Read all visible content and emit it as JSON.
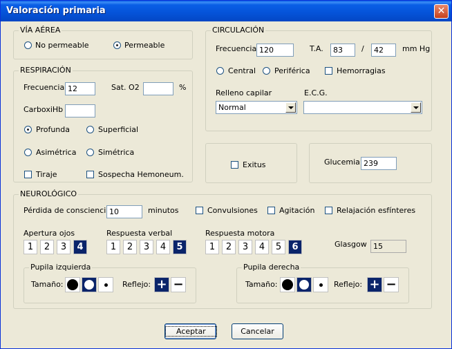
{
  "window": {
    "title": "Valoración primaria",
    "close_glyph": "✕"
  },
  "via_aerea": {
    "legend": "VÍA AÉREA",
    "options": [
      {
        "label": "No permeable",
        "checked": false
      },
      {
        "label": "Permeable",
        "checked": true
      }
    ]
  },
  "respiracion": {
    "legend": "RESPIRACIÓN",
    "frecuencia_label": "Frecuencia",
    "frecuencia_value": "12",
    "sat_label": "Sat. O2",
    "sat_value": "",
    "sat_unit": "%",
    "carboxi_label": "CarboxiHb",
    "carboxi_value": "",
    "profundidad": [
      {
        "label": "Profunda",
        "checked": true
      },
      {
        "label": "Superficial",
        "checked": false
      }
    ],
    "simetria": [
      {
        "label": "Asimétrica",
        "checked": false
      },
      {
        "label": "Simétrica",
        "checked": false
      }
    ],
    "tiraje_label": "Tiraje",
    "hemoneum_label": "Sospecha Hemoneum."
  },
  "circulacion": {
    "legend": "CIRCULACIÓN",
    "frecuencia_label": "Frecuencia",
    "frecuencia_value": "120",
    "ta_label": "T.A.",
    "ta_sys": "83",
    "ta_sep": "/",
    "ta_dia": "42",
    "ta_unit": "mm Hg",
    "pulso": [
      {
        "label": "Central",
        "checked": false
      },
      {
        "label": "Periférica",
        "checked": false
      }
    ],
    "hemorragias_label": "Hemorragias",
    "relleno_label": "Relleno capilar",
    "relleno_value": "Normal",
    "ecg_label": "E.C.G.",
    "ecg_value": ""
  },
  "exitus": {
    "label": "Exitus"
  },
  "glucemia": {
    "label": "Glucemia",
    "value": "239"
  },
  "neurologico": {
    "legend": "NEUROLÓGICO",
    "perdida_label": "Pérdida de consciencia",
    "perdida_value": "10",
    "minutos_label": "minutos",
    "convulsiones_label": "Convulsiones",
    "agitacion_label": "Agitación",
    "relajacion_label": "Relajación esfínteres",
    "apertura": {
      "label": "Apertura ojos",
      "options": [
        "1",
        "2",
        "3",
        "4"
      ],
      "selected": "4"
    },
    "verbal": {
      "label": "Respuesta verbal",
      "options": [
        "1",
        "2",
        "3",
        "4",
        "5"
      ],
      "selected": "5"
    },
    "motora": {
      "label": "Respuesta motora",
      "options": [
        "1",
        "2",
        "3",
        "4",
        "5",
        "6"
      ],
      "selected": "6"
    },
    "glasgow_label": "Glasgow",
    "glasgow_value": "15",
    "pupila_izq": {
      "legend": "Pupila izquierda",
      "tamano_label": "Tamaño:",
      "tamano_selected": "medium",
      "reflejo_label": "Reflejo:",
      "reflejo_selected": "plus"
    },
    "pupila_der": {
      "legend": "Pupila derecha",
      "tamano_label": "Tamaño:",
      "tamano_selected": "medium",
      "reflejo_label": "Reflejo:",
      "reflejo_selected": "plus"
    }
  },
  "buttons": {
    "accept_label": "Aceptar",
    "cancel_label": "Cancelar"
  },
  "icons": {
    "plus": "+",
    "minus": "−"
  },
  "colors": {
    "titlebar": "#0553d8",
    "selected": "#0a246a",
    "background": "#ece9d8"
  }
}
